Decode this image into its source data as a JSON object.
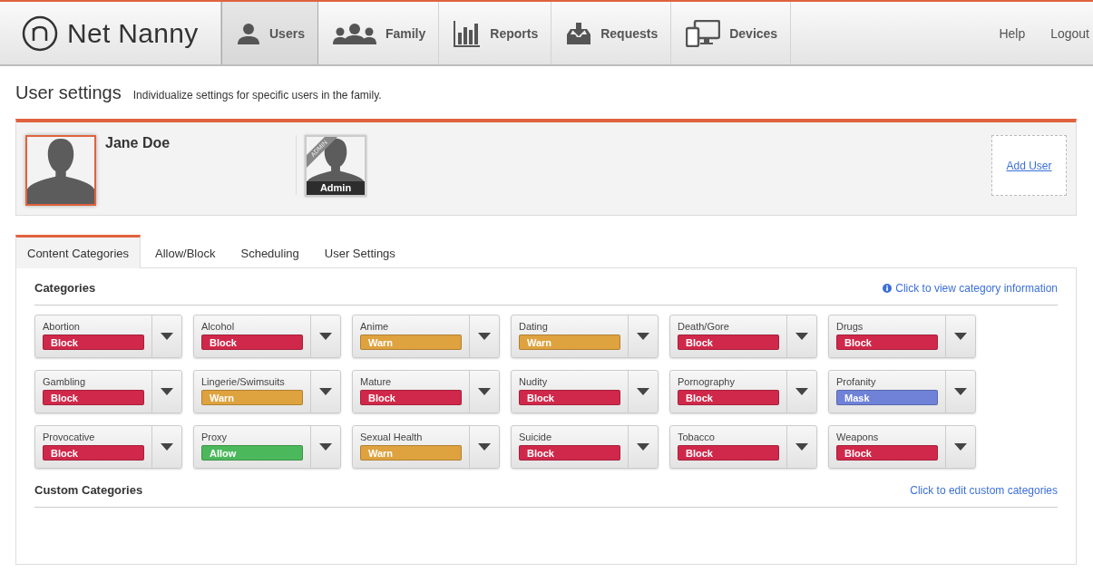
{
  "header": {
    "brand": "Net Nanny",
    "nav": [
      {
        "kind": "user",
        "label": "Users",
        "selected": true
      },
      {
        "kind": "family",
        "label": "Family",
        "selected": false
      },
      {
        "kind": "reports",
        "label": "Reports",
        "selected": false
      },
      {
        "kind": "requests",
        "label": "Requests",
        "selected": false
      },
      {
        "kind": "devices",
        "label": "Devices",
        "selected": false
      }
    ],
    "links": [
      "Help",
      "Logout"
    ]
  },
  "page": {
    "title": "User settings",
    "subtitle": "Individualize settings for specific users in the family."
  },
  "users": {
    "current": {
      "name": "Jane Doe",
      "selected": true
    },
    "others": [
      {
        "ribbon": "ADMIN",
        "label": "Admin"
      }
    ],
    "add_user": "Add User"
  },
  "tabs": [
    {
      "label": "Content Categories",
      "selected": true
    },
    {
      "label": "Allow/Block",
      "selected": false
    },
    {
      "label": "Scheduling",
      "selected": false
    },
    {
      "label": "User Settings",
      "selected": false
    }
  ],
  "categories": {
    "title": "Categories",
    "info_link": "Click to view category information",
    "items": [
      {
        "name": "Abortion",
        "setting": "Block",
        "color": "#d0284a"
      },
      {
        "name": "Alcohol",
        "setting": "Block",
        "color": "#d0284a"
      },
      {
        "name": "Anime",
        "setting": "Warn",
        "color": "#dea23e"
      },
      {
        "name": "Dating",
        "setting": "Warn",
        "color": "#dea23e"
      },
      {
        "name": "Death/Gore",
        "setting": "Block",
        "color": "#d0284a"
      },
      {
        "name": "Drugs",
        "setting": "Block",
        "color": "#d0284a"
      },
      {
        "name": "Gambling",
        "setting": "Block",
        "color": "#d0284a"
      },
      {
        "name": "Lingerie/Swimsuits",
        "setting": "Warn",
        "color": "#dea23e"
      },
      {
        "name": "Mature",
        "setting": "Block",
        "color": "#d0284a"
      },
      {
        "name": "Nudity",
        "setting": "Block",
        "color": "#d0284a"
      },
      {
        "name": "Pornography",
        "setting": "Block",
        "color": "#d0284a"
      },
      {
        "name": "Profanity",
        "setting": "Mask",
        "color": "#6f82d8"
      },
      {
        "name": "Provocative",
        "setting": "Block",
        "color": "#d0284a"
      },
      {
        "name": "Proxy",
        "setting": "Allow",
        "color": "#4cb85c"
      },
      {
        "name": "Sexual Health",
        "setting": "Warn",
        "color": "#dea23e"
      },
      {
        "name": "Suicide",
        "setting": "Block",
        "color": "#d0284a"
      },
      {
        "name": "Tobacco",
        "setting": "Block",
        "color": "#d0284a"
      },
      {
        "name": "Weapons",
        "setting": "Block",
        "color": "#d0284a"
      }
    ]
  },
  "custom": {
    "title": "Custom Categories",
    "edit_link": "Click to edit custom categories"
  }
}
